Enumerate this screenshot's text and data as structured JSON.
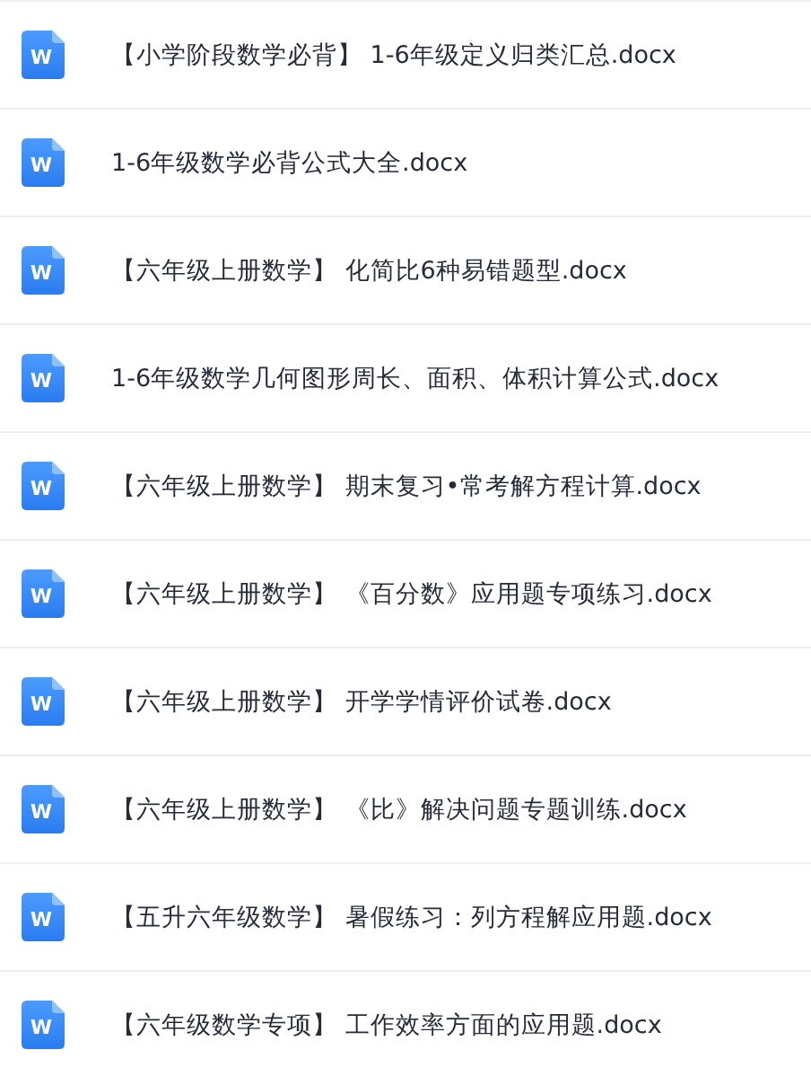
{
  "files": [
    {
      "name": "【小学阶段数学必背】 1-6年级定义归类汇总.docx",
      "kind": "word",
      "icon_text": "W"
    },
    {
      "name": "1-6年级数学必背公式大全.docx",
      "kind": "word",
      "icon_text": "W"
    },
    {
      "name": "【六年级上册数学】 化简比6种易错题型.docx",
      "kind": "word",
      "icon_text": "W"
    },
    {
      "name": "1-6年级数学几何图形周长、面积、体积计算公式.docx",
      "kind": "word",
      "icon_text": "W"
    },
    {
      "name": "【六年级上册数学】 期末复习•常考解方程计算.docx",
      "kind": "word",
      "icon_text": "W"
    },
    {
      "name": "【六年级上册数学】 《百分数》应用题专项练习.docx",
      "kind": "word",
      "icon_text": "W"
    },
    {
      "name": "【六年级上册数学】 开学学情评价试卷.docx",
      "kind": "word",
      "icon_text": "W"
    },
    {
      "name": "【六年级上册数学】 《比》解决问题专题训练.docx",
      "kind": "word",
      "icon_text": "W"
    },
    {
      "name": "【五升六年级数学】 暑假练习：列方程解应用题.docx",
      "kind": "word",
      "icon_text": "W"
    },
    {
      "name": "【六年级数学专项】 工作效率方面的应用题.docx",
      "kind": "word",
      "icon_text": "W"
    }
  ]
}
